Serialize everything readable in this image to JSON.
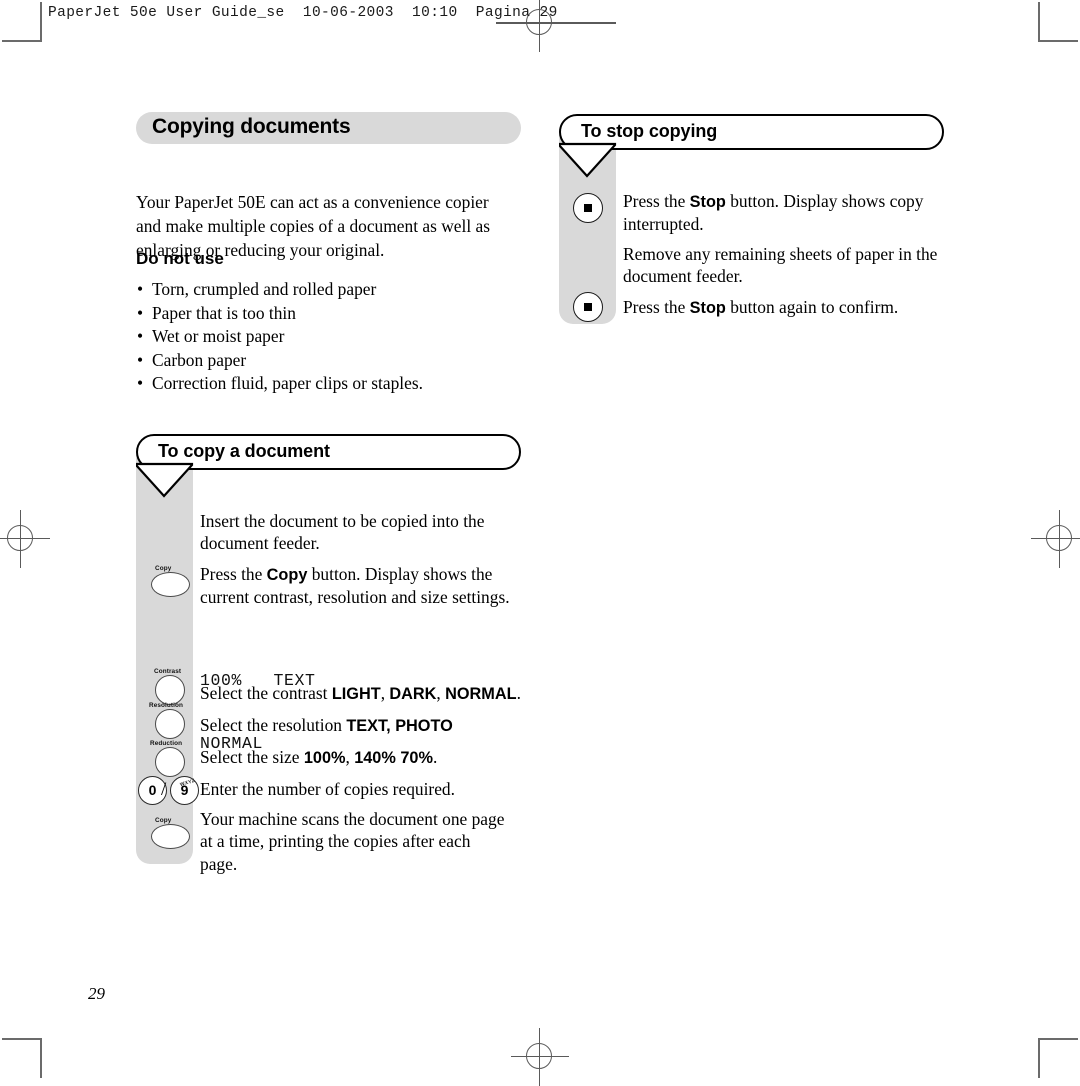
{
  "print_marks": {
    "slug_line": "PaperJet 50e User Guide_se  10-06-2003  10:10  Pagina 29",
    "folio": "29"
  },
  "left_column": {
    "chapter_title": "Copying documents",
    "intro": "Your PaperJet 50E can act as a convenience copier and make multiple copies of a document as well as enlarging or reducing your original.",
    "do_not_use": {
      "heading": "Do not use",
      "bullet_char": "•",
      "items": [
        "Torn, crumpled and rolled paper",
        "Paper that is too thin",
        "Wet or moist paper",
        "Carbon paper",
        "Correction fluid, paper clips or staples."
      ]
    },
    "copy_procedure": {
      "callout_title": "To copy a document",
      "buttons": [
        {
          "caption": "Copy",
          "shape": "oval"
        },
        {
          "caption": "Contrast",
          "shape": "round"
        },
        {
          "caption": "Resolution",
          "shape": "round"
        },
        {
          "caption": "Reduction",
          "shape": "round"
        },
        {
          "caption": "Copy",
          "shape": "oval"
        }
      ],
      "keypad": {
        "key_low": "0",
        "key_high": "9",
        "key_high_letters": "WXYZ",
        "separator": "/"
      },
      "steps": [
        {
          "id": "insert",
          "parts": [
            {
              "text": "Insert the document to be copied into the document feeder.",
              "bold": false
            }
          ]
        },
        {
          "id": "press-copy",
          "parts": [
            {
              "text": "Press the ",
              "bold": false
            },
            {
              "text": "Copy",
              "bold": true
            },
            {
              "text": " button. Display shows the current contrast, resolution and size settings.",
              "bold": false
            }
          ]
        },
        {
          "id": "select-contrast",
          "parts": [
            {
              "text": "Select the contrast ",
              "bold": false
            },
            {
              "text": "LIGHT",
              "bold": true
            },
            {
              "text": ", ",
              "bold": false
            },
            {
              "text": "DARK",
              "bold": true
            },
            {
              "text": ", ",
              "bold": false
            },
            {
              "text": "NORMAL",
              "bold": true
            },
            {
              "text": ".",
              "bold": false
            }
          ]
        },
        {
          "id": "select-resolution",
          "parts": [
            {
              "text": "Select the resolution ",
              "bold": false
            },
            {
              "text": "TEXT, PHOTO",
              "bold": true
            }
          ]
        },
        {
          "id": "select-size",
          "parts": [
            {
              "text": "Select the size ",
              "bold": false
            },
            {
              "text": "100%",
              "bold": true
            },
            {
              "text": ", ",
              "bold": false
            },
            {
              "text": "140% 70%",
              "bold": true
            },
            {
              "text": ".",
              "bold": false
            }
          ]
        },
        {
          "id": "enter-copies",
          "parts": [
            {
              "text": "Enter the number of copies required.",
              "bold": false
            }
          ]
        },
        {
          "id": "scanning",
          "parts": [
            {
              "text": "Your machine scans the document one page at a time, printing the copies after each page.",
              "bold": false
            }
          ]
        }
      ],
      "lcd": {
        "line1": "100%   TEXT",
        "line2": "NORMAL"
      }
    }
  },
  "right_column": {
    "stop_procedure": {
      "callout_title": "To stop copying",
      "steps": [
        {
          "id": "press-stop",
          "has_button": true,
          "button": "stop",
          "parts": [
            {
              "text": "Press the ",
              "bold": false
            },
            {
              "text": "Stop",
              "bold": true
            },
            {
              "text": " button. Display shows copy interrupted.",
              "bold": false
            }
          ]
        },
        {
          "id": "remove-sheets",
          "has_button": false,
          "parts": [
            {
              "text": "Remove any remaining sheets of paper in the document feeder.",
              "bold": false
            }
          ]
        },
        {
          "id": "press-stop-again",
          "has_button": true,
          "button": "stop",
          "parts": [
            {
              "text": "Press the ",
              "bold": false
            },
            {
              "text": "Stop",
              "bold": true
            },
            {
              "text": " button again to confirm.",
              "bold": false
            }
          ]
        }
      ]
    }
  },
  "colors": {
    "strip_gray": "#d9d9d9",
    "title_pill_gray": "#d9d9d9",
    "ink": "#000000",
    "mark_gray": "#5a5a5a"
  }
}
